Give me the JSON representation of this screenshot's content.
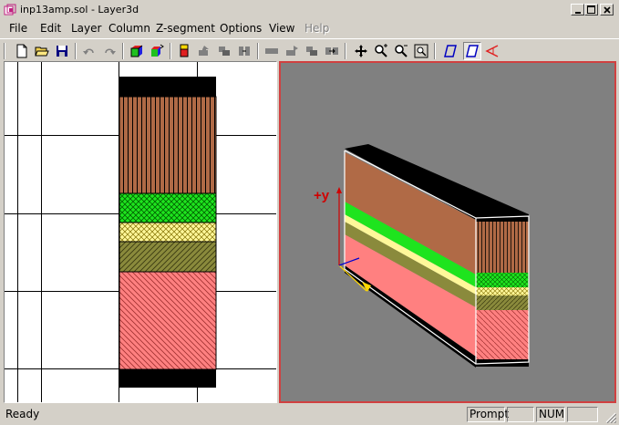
{
  "window": {
    "title": "inp13amp.sol - Layer3d",
    "icon": "layer-app-icon"
  },
  "menu": [
    {
      "label": "File",
      "enabled": true
    },
    {
      "label": "Edit",
      "enabled": true
    },
    {
      "label": "Layer",
      "enabled": true
    },
    {
      "label": "Column",
      "enabled": true
    },
    {
      "label": "Z-segment",
      "enabled": true
    },
    {
      "label": "Options",
      "enabled": true
    },
    {
      "label": "View",
      "enabled": true
    },
    {
      "label": "Help",
      "enabled": false
    }
  ],
  "toolbar": {
    "buttons": [
      "new-file-icon",
      "open-folder-icon",
      "save-disk-icon",
      "undo-icon",
      "redo-icon",
      "color-cube-icon",
      "rotate-cube-icon",
      "red-block-icon",
      "layer-move-up-icon",
      "layer-copy-icon",
      "layer-split-icon",
      "column-delete-icon",
      "column-move-icon",
      "column-copy-icon",
      "column-split-icon",
      "pan-icon",
      "zoom-in-icon",
      "zoom-out-icon",
      "zoom-fit-icon",
      "parallelogram-blue-icon",
      "parallelogram-outline-icon",
      "triangle-red-icon"
    ]
  },
  "status": {
    "ready": "Ready",
    "prompt": "Prompt",
    "num": "NUM"
  },
  "axis_label": "+y",
  "colors": {
    "black": "#000000",
    "brown": "#b06a46",
    "green": "#1ee41e",
    "yellow": "#fff79a",
    "olive": "#8a8a3c",
    "pink": "#ff8080",
    "accent_red": "#d04040"
  }
}
